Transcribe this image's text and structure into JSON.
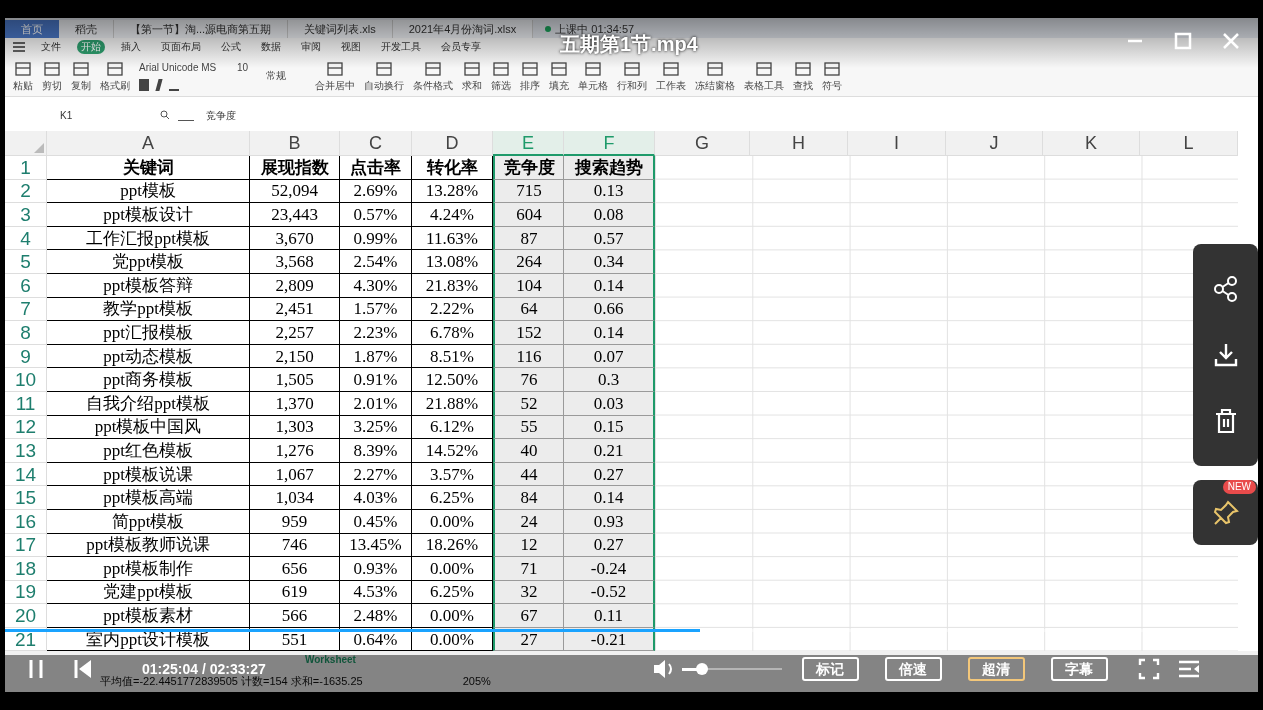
{
  "player": {
    "title": "五期第1节.mp4",
    "progress": {
      "level": 0.554
    },
    "time": "01:25:04 / 02:33:27",
    "volume": {
      "level": 0.2
    },
    "buttons": [
      {
        "label": "标记",
        "selected": false
      },
      {
        "label": "倍速",
        "selected": false
      },
      {
        "label": "超清",
        "selected": true
      },
      {
        "label": "字幕",
        "selected": false
      }
    ],
    "pin_badge": "NEW"
  },
  "app": {
    "tabs": [
      {
        "label": "首页",
        "selected": true
      },
      {
        "label": "稻壳",
        "selected": false
      },
      {
        "label": "【第一节】淘...源电商第五期",
        "selected": false
      },
      {
        "label": "关键词列表.xls",
        "selected": false
      },
      {
        "label": "2021年4月份淘词.xlsx",
        "selected": false
      }
    ],
    "recording": "上课中 01:34:57",
    "menu": [
      {
        "label": "文件",
        "selected": false
      },
      {
        "label": "开始",
        "selected": true
      },
      {
        "label": "插入",
        "selected": false
      },
      {
        "label": "页面布局",
        "selected": false
      },
      {
        "label": "公式",
        "selected": false
      },
      {
        "label": "数据",
        "selected": false
      },
      {
        "label": "审阅",
        "selected": false
      },
      {
        "label": "视图",
        "selected": false
      },
      {
        "label": "开发工具",
        "selected": false
      },
      {
        "label": "会员专享",
        "selected": false
      }
    ],
    "font_name": "Arial Unicode MS",
    "font_size": "10",
    "number_format": "常规",
    "ribbon_left": [
      "粘贴",
      "剪切",
      "复制",
      "格式刷"
    ],
    "ribbon_right": [
      "合并居中",
      "自动换行",
      "条件格式",
      "求和",
      "筛选",
      "排序",
      "填充",
      "单元格",
      "行和列",
      "工作表",
      "冻结窗格",
      "表格工具",
      "查找",
      "符号"
    ],
    "name_box": "K1",
    "formula": "竞争度",
    "columns": [
      {
        "label": "A",
        "selected": false
      },
      {
        "label": "B",
        "selected": false
      },
      {
        "label": "C",
        "selected": false
      },
      {
        "label": "D",
        "selected": false
      },
      {
        "label": "E",
        "selected": true
      },
      {
        "label": "F",
        "selected": true
      },
      {
        "label": "G",
        "selected": false
      },
      {
        "label": "H",
        "selected": false
      },
      {
        "label": "I",
        "selected": false
      },
      {
        "label": "J",
        "selected": false
      },
      {
        "label": "K",
        "selected": false
      },
      {
        "label": "L",
        "selected": false
      }
    ],
    "rows": [
      {
        "number": "1",
        "cells": [
          "关键词",
          "展现指数",
          "点击率",
          "转化率",
          "竞争度",
          "搜索趋势"
        ]
      },
      {
        "number": "2",
        "cells": [
          "ppt模板",
          "52,094",
          "2.69%",
          "13.28%",
          "715",
          "0.13"
        ]
      },
      {
        "number": "3",
        "cells": [
          "ppt模板设计",
          "23,443",
          "0.57%",
          "4.24%",
          "604",
          "0.08"
        ]
      },
      {
        "number": "4",
        "cells": [
          "工作汇报ppt模板",
          "3,670",
          "0.99%",
          "11.63%",
          "87",
          "0.57"
        ]
      },
      {
        "number": "5",
        "cells": [
          "党ppt模板",
          "3,568",
          "2.54%",
          "13.08%",
          "264",
          "0.34"
        ]
      },
      {
        "number": "6",
        "cells": [
          "ppt模板答辩",
          "2,809",
          "4.30%",
          "21.83%",
          "104",
          "0.14"
        ]
      },
      {
        "number": "7",
        "cells": [
          "教学ppt模板",
          "2,451",
          "1.57%",
          "2.22%",
          "64",
          "0.66"
        ]
      },
      {
        "number": "8",
        "cells": [
          "ppt汇报模板",
          "2,257",
          "2.23%",
          "6.78%",
          "152",
          "0.14"
        ]
      },
      {
        "number": "9",
        "cells": [
          "ppt动态模板",
          "2,150",
          "1.87%",
          "8.51%",
          "116",
          "0.07"
        ]
      },
      {
        "number": "10",
        "cells": [
          "ppt商务模板",
          "1,505",
          "0.91%",
          "12.50%",
          "76",
          "0.3"
        ]
      },
      {
        "number": "11",
        "cells": [
          "自我介绍ppt模板",
          "1,370",
          "2.01%",
          "21.88%",
          "52",
          "0.03"
        ]
      },
      {
        "number": "12",
        "cells": [
          "ppt模板中国风",
          "1,303",
          "3.25%",
          "6.12%",
          "55",
          "0.15"
        ]
      },
      {
        "number": "13",
        "cells": [
          "ppt红色模板",
          "1,276",
          "8.39%",
          "14.52%",
          "40",
          "0.21"
        ]
      },
      {
        "number": "14",
        "cells": [
          "ppt模板说课",
          "1,067",
          "2.27%",
          "3.57%",
          "44",
          "0.27"
        ]
      },
      {
        "number": "15",
        "cells": [
          "ppt模板高端",
          "1,034",
          "4.03%",
          "6.25%",
          "84",
          "0.14"
        ]
      },
      {
        "number": "16",
        "cells": [
          "简ppt模板",
          "959",
          "0.45%",
          "0.00%",
          "24",
          "0.93"
        ]
      },
      {
        "number": "17",
        "cells": [
          "ppt模板教师说课",
          "746",
          "13.45%",
          "18.26%",
          "12",
          "0.27"
        ]
      },
      {
        "number": "18",
        "cells": [
          "ppt模板制作",
          "656",
          "0.93%",
          "0.00%",
          "71",
          "-0.24"
        ]
      },
      {
        "number": "19",
        "cells": [
          "党建ppt模板",
          "619",
          "4.53%",
          "6.25%",
          "32",
          "-0.52"
        ]
      },
      {
        "number": "20",
        "cells": [
          "ppt模板素材",
          "566",
          "2.48%",
          "0.00%",
          "67",
          "0.11"
        ]
      },
      {
        "number": "21",
        "cells": [
          "室内ppt设计模板",
          "551",
          "0.64%",
          "0.00%",
          "27",
          "-0.21"
        ]
      }
    ],
    "sheet_tab": "Worksheet",
    "status_bar": "平均值=-22.4451772839505  计数=154  求和=-1635.25",
    "zoom": "205%"
  }
}
